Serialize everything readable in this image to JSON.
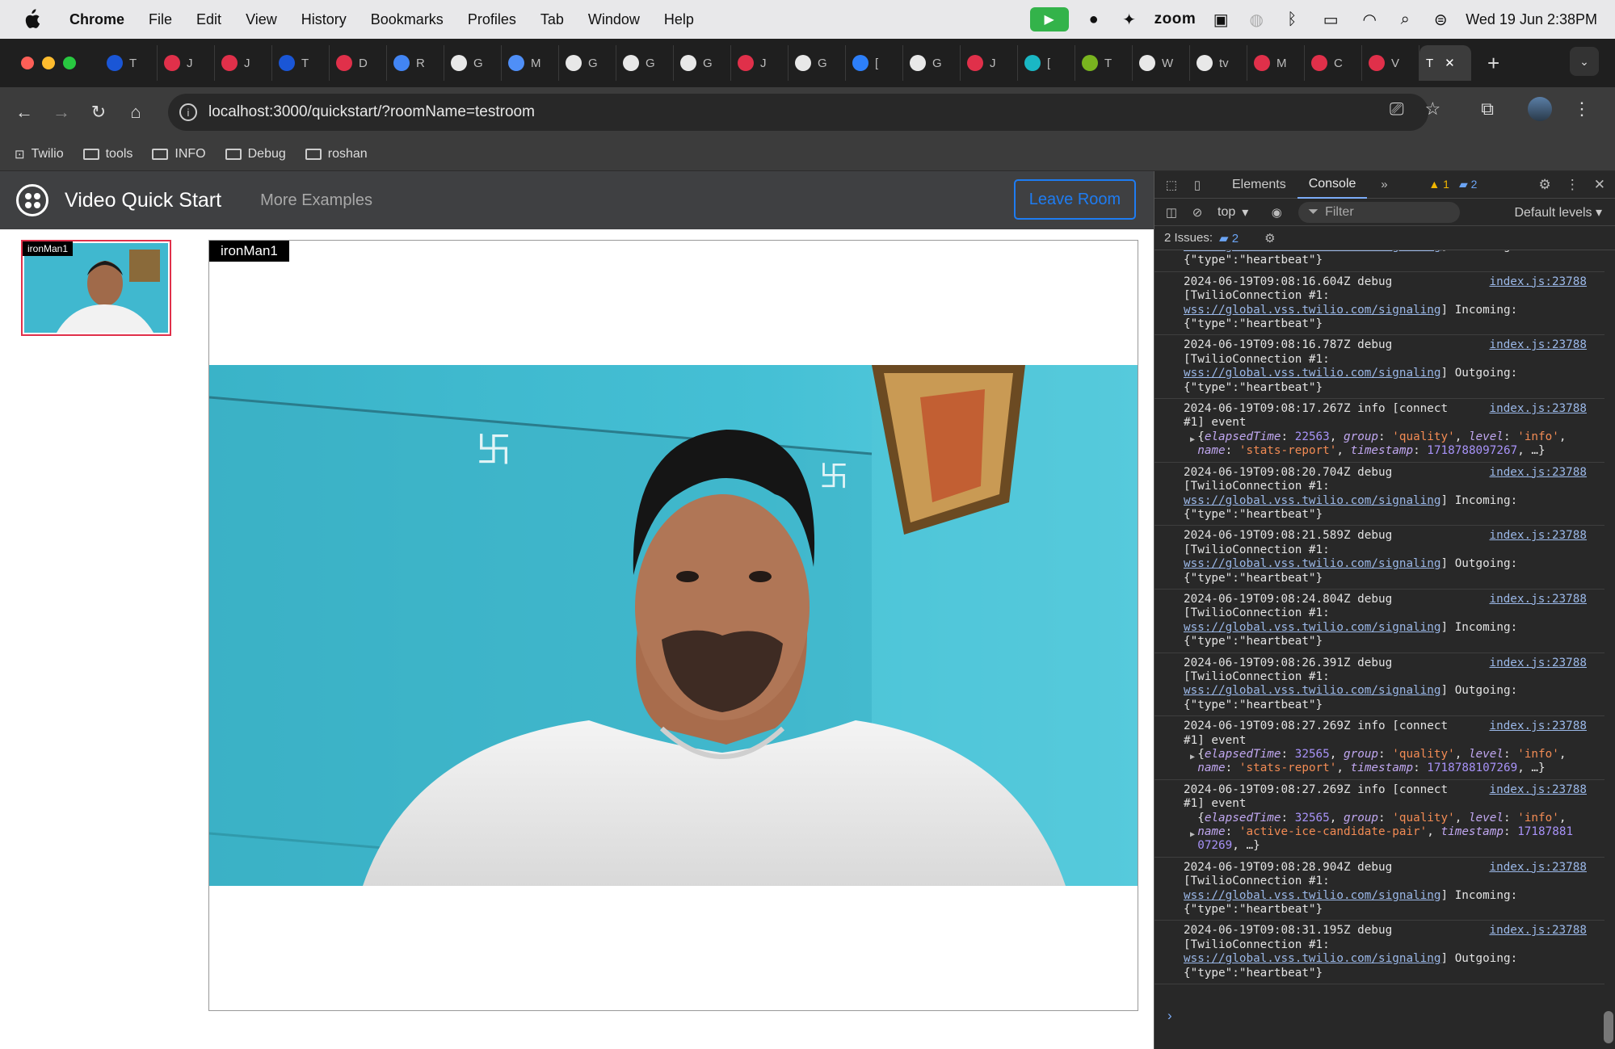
{
  "menubar": {
    "app": "Chrome",
    "items": [
      "File",
      "Edit",
      "View",
      "History",
      "Bookmarks",
      "Profiles",
      "Tab",
      "Window",
      "Help"
    ],
    "zoom_label": "zoom",
    "clock": "Wed 19 Jun  2:38PM"
  },
  "tabs": [
    {
      "letter": "T",
      "color": "#1a56d6"
    },
    {
      "letter": "J",
      "color": "#e0304a"
    },
    {
      "letter": "J",
      "color": "#e0304a"
    },
    {
      "letter": "T",
      "color": "#1a56d6"
    },
    {
      "letter": "D",
      "color": "#e0304a"
    },
    {
      "letter": "R",
      "color": "#4285f4"
    },
    {
      "letter": "G",
      "color": "#e8e8e8"
    },
    {
      "letter": "M",
      "color": "#4f8ff7"
    },
    {
      "letter": "G",
      "color": "#e8e8e8"
    },
    {
      "letter": "G",
      "color": "#e8e8e8"
    },
    {
      "letter": "G",
      "color": "#e8e8e8"
    },
    {
      "letter": "J",
      "color": "#e0304a"
    },
    {
      "letter": "G",
      "color": "#e8e8e8"
    },
    {
      "letter": "[",
      "color": "#2d7ff9"
    },
    {
      "letter": "G",
      "color": "#e8e8e8"
    },
    {
      "letter": "J",
      "color": "#e0304a"
    },
    {
      "letter": "[",
      "color": "#1ab7c4"
    },
    {
      "letter": "T",
      "color": "#79b41f"
    },
    {
      "letter": "W",
      "color": "#e8e8e8"
    },
    {
      "letter": "tv",
      "color": "#e8e8e8"
    },
    {
      "letter": "M",
      "color": "#e0304a"
    },
    {
      "letter": "C",
      "color": "#e0304a"
    },
    {
      "letter": "V",
      "color": "#e0304a"
    }
  ],
  "active_tab": {
    "letter": "T",
    "close": "✕"
  },
  "new_tab": "+",
  "address": {
    "url": "localhost:3000/quickstart/?roomName=testroom"
  },
  "bookmarks": [
    "Twilio",
    "tools",
    "INFO",
    "Debug",
    "roshan"
  ],
  "app": {
    "title": "Video Quick Start",
    "more": "More Examples",
    "leave": "Leave Room",
    "participant": "ironMan1"
  },
  "devtools": {
    "tabs": [
      "Elements",
      "Console"
    ],
    "more": "»",
    "warn_count": "1",
    "msg_count": "2",
    "context": "top",
    "filter": "Filter",
    "levels": "Default levels ▾",
    "issues_label": "2 Issues:",
    "issues_count": "2",
    "prompt": "›"
  },
  "console": [
    {
      "type": "frag",
      "text": "{\"type\":\"heartbeat\"}",
      "frag_url": "wss://global.vss.twilio.com/signaling",
      "frag_tail": "] Incoming:"
    },
    {
      "type": "hb",
      "ts": "2024-06-19T09:08:16.604Z debug",
      "src": "index.js:23788",
      "dir": "Incoming:"
    },
    {
      "type": "hb",
      "ts": "2024-06-19T09:08:16.787Z debug",
      "src": "index.js:23788",
      "dir": "Outgoing:"
    },
    {
      "type": "ev",
      "ts": "2024-06-19T09:08:17.267Z info [connect",
      "src": "index.js:23788",
      "elapsed": "22563",
      "name": "'stats-report'",
      "stamp": "1718788097267"
    },
    {
      "type": "hb",
      "ts": "2024-06-19T09:08:20.704Z debug",
      "src": "index.js:23788",
      "dir": "Incoming:"
    },
    {
      "type": "hb",
      "ts": "2024-06-19T09:08:21.589Z debug",
      "src": "index.js:23788",
      "dir": "Outgoing:"
    },
    {
      "type": "hb",
      "ts": "2024-06-19T09:08:24.804Z debug",
      "src": "index.js:23788",
      "dir": "Incoming:"
    },
    {
      "type": "hb",
      "ts": "2024-06-19T09:08:26.391Z debug",
      "src": "index.js:23788",
      "dir": "Outgoing:"
    },
    {
      "type": "ev",
      "ts": "2024-06-19T09:08:27.269Z info [connect",
      "src": "index.js:23788",
      "elapsed": "32565",
      "name": "'stats-report'",
      "stamp": "1718788107269"
    },
    {
      "type": "ev2",
      "ts": "2024-06-19T09:08:27.269Z info [connect",
      "src": "index.js:23788",
      "elapsed": "32565",
      "name": "'active-ice-candidate-pair'",
      "stamp1": "17187881",
      "stamp2": "07269"
    },
    {
      "type": "hb",
      "ts": "2024-06-19T09:08:28.904Z debug",
      "src": "index.js:23788",
      "dir": "Incoming:"
    },
    {
      "type": "hb",
      "ts": "2024-06-19T09:08:31.195Z debug",
      "src": "index.js:23788",
      "dir": "Outgoing:"
    }
  ],
  "console_text": {
    "conn": "[TwilioConnection #1:",
    "wss": "wss://global.vss.twilio.com/signaling",
    "hb": "{\"type\":\"heartbeat\"}",
    "event": "#1] event",
    "group": "'quality'",
    "level": "'info'",
    "ellipsis": "…}"
  }
}
